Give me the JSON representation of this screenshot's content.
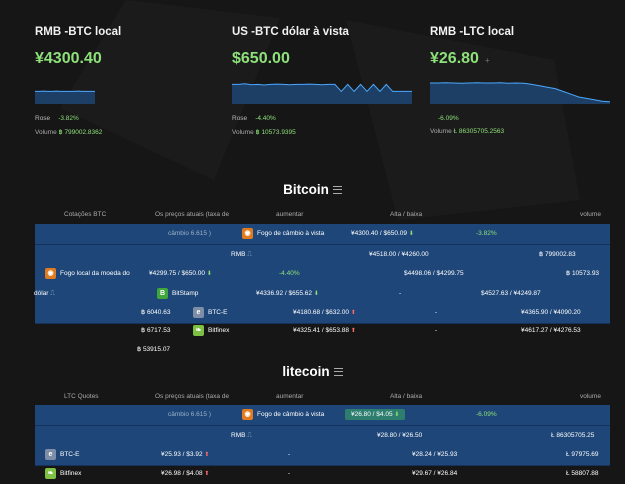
{
  "cards": [
    {
      "title": "RMB -BTC local",
      "price": "¥4300.40",
      "price_suffix": "",
      "rose_label": "Rose",
      "change": "-3.82%",
      "volume_label": "Volume",
      "volume": "฿ 799002.8362"
    },
    {
      "title": "US -BTC dólar à vista",
      "price": "$650.00",
      "price_suffix": "",
      "rose_label": "Rose",
      "change": "-4.40%",
      "volume_label": "Volume",
      "volume": "฿ 10573.9395"
    },
    {
      "title": "RMB -LTC local",
      "price": "¥26.80",
      "price_suffix": "+",
      "rose_label": "",
      "change": "-6.09%",
      "volume_label": "Volume",
      "volume": "Ł 86305705.2563"
    }
  ],
  "bitcoin": {
    "title": "Bitcoin",
    "headers": {
      "col1": "Cotações BTC",
      "col2": "Os preços atuais (taxa de",
      "col3": "aumentar",
      "col4": "Alta / baixa",
      "col5": "volume"
    },
    "row1": {
      "rate": "câmbio 6.615 )",
      "name": "Fogo de câmbio à vista",
      "price": "¥4300.40 / $650.09",
      "change": "-3.82%"
    },
    "row2": {
      "name": "RMB",
      "highlow": "¥4518.00 / ¥4260.00",
      "volume": "฿ 799002.83"
    },
    "row3": {
      "name": "Fogo local da moeda do",
      "price": "¥4299.75 / $650.00",
      "change": "-4.40%",
      "highlow": "$4498.06 / $4299.75",
      "volume": "฿ 10573.93"
    },
    "row4": {
      "prefix": "dólar",
      "name": "BitStamp",
      "price": "¥4336.92 / $655.62",
      "change": "-",
      "highlow": "$4527.63 / ¥4249.87"
    },
    "row5": {
      "volume": "฿ 6040.63",
      "name": "BTC-E",
      "price": "¥4180.68 / $632.00",
      "change": "-",
      "highlow": "¥4365.90 / ¥4090.20"
    },
    "row6": {
      "volume": "฿ 6717.53",
      "name": "Bitfinex",
      "price": "¥4325.41 / $653.88",
      "change": "-",
      "highlow": "¥4617.27 / ¥4276.53"
    },
    "extra_volume": "฿ 53915.07"
  },
  "litecoin": {
    "title": "litecoin",
    "headers": {
      "col1": "LTC Quotes",
      "col2": "Os preços atuais (taxa de",
      "col3": "aumentar",
      "col4": "Alta / baixa",
      "col5": "volume"
    },
    "row1": {
      "rate": "câmbio 6.615 )",
      "name": "Fogo de câmbio à vista",
      "price": "¥26.80 / $4.05",
      "change": "-6.09%"
    },
    "row2": {
      "name": "RMB",
      "highlow": "¥28.80 / ¥26.50",
      "volume": "Ł 86305705.25"
    },
    "row3": {
      "name": "BTC-E",
      "price": "¥25.93 / $3.92",
      "change": "-",
      "highlow": "¥28.24 / ¥25.93",
      "volume": "Ł 97975.69"
    },
    "row4": {
      "name": "Bitfinex",
      "price": "¥26.98 / $4.08",
      "change": "-",
      "highlow": "¥29.67 / ¥26.84",
      "volume": "Ł 58807.88"
    }
  },
  "colors": {
    "accent_green": "#8ee07a",
    "row_blue": "#1e4678",
    "spark_line": "#4aa8ff"
  },
  "sparklines": [
    [
      0.55,
      0.55,
      0.54,
      0.55,
      0.55,
      0.54,
      0.55,
      0.55,
      0.55,
      0.55,
      0.54,
      0.55,
      0.55,
      0.55,
      0.55
    ],
    [
      0.3,
      0.3,
      0.28,
      0.31,
      0.3,
      0.32,
      0.3,
      0.29,
      0.3,
      0.31,
      0.3,
      0.3,
      0.29,
      0.3,
      0.31,
      0.3,
      0.3,
      0.55,
      0.3,
      0.55,
      0.3,
      0.55,
      0.3,
      0.55,
      0.3,
      0.55,
      0.55,
      0.55,
      0.55
    ],
    [
      0.25,
      0.25,
      0.24,
      0.25,
      0.26,
      0.25,
      0.24,
      0.25,
      0.25,
      0.24,
      0.26,
      0.25,
      0.26,
      0.3,
      0.35,
      0.4,
      0.45,
      0.55,
      0.65,
      0.75,
      0.8,
      0.85,
      0.9,
      0.92
    ]
  ]
}
